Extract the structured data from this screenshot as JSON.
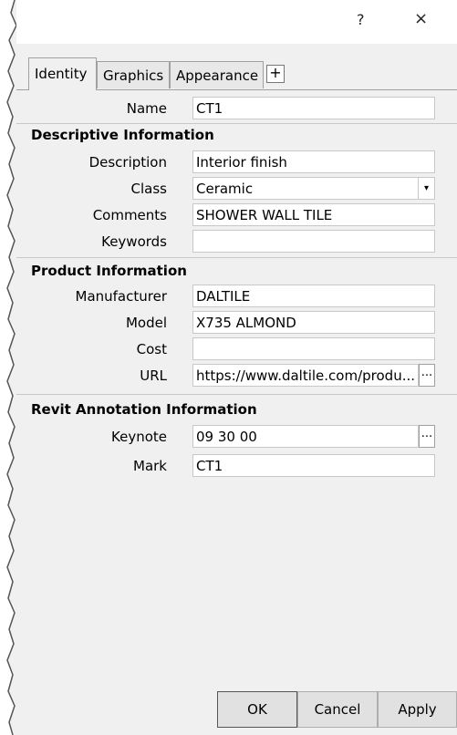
{
  "window": {
    "help_glyph": "?",
    "close_glyph": "×"
  },
  "tabs": [
    {
      "label": "Identity",
      "active": true
    },
    {
      "label": "Graphics",
      "active": false
    },
    {
      "label": "Appearance",
      "active": false
    }
  ],
  "add_tab_glyph": "+",
  "name": {
    "label": "Name",
    "value": "CT1"
  },
  "descriptive": {
    "header": "Descriptive Information",
    "description": {
      "label": "Description",
      "value": "Interior finish"
    },
    "class": {
      "label": "Class",
      "value": "Ceramic"
    },
    "comments": {
      "label": "Comments",
      "value": "SHOWER WALL TILE"
    },
    "keywords": {
      "label": "Keywords",
      "value": ""
    }
  },
  "product": {
    "header": "Product Information",
    "manufacturer": {
      "label": "Manufacturer",
      "value": "DALTILE"
    },
    "model": {
      "label": "Model",
      "value": "X735 ALMOND"
    },
    "cost": {
      "label": "Cost",
      "value": ""
    },
    "url": {
      "label": "URL",
      "value": "https://www.daltile.com/produ..."
    }
  },
  "revit": {
    "header": "Revit Annotation Information",
    "keynote": {
      "label": "Keynote",
      "value": "09 30 00"
    },
    "mark": {
      "label": "Mark",
      "value": "CT1"
    }
  },
  "ellipsis": "...",
  "dropdown_arrow": "▾",
  "buttons": {
    "ok": "OK",
    "cancel": "Cancel",
    "apply": "Apply"
  }
}
